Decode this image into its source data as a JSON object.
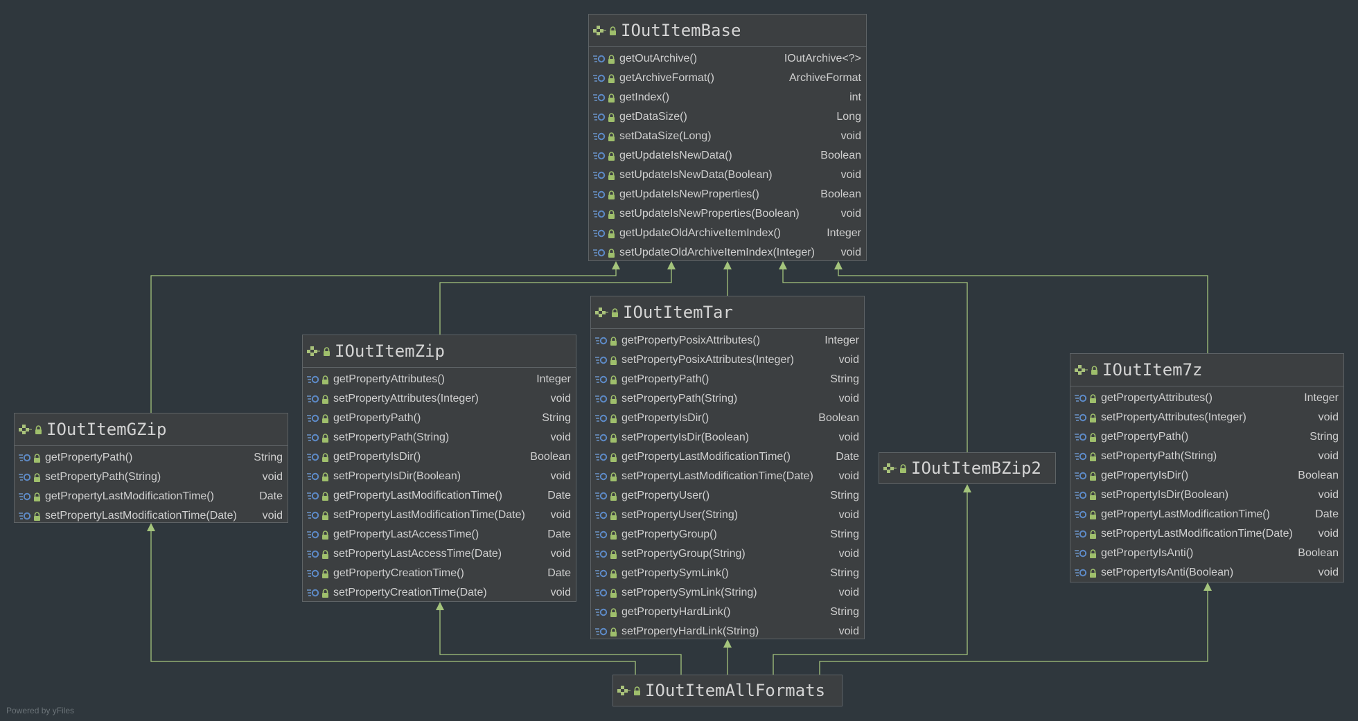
{
  "colors": {
    "background": "#2f373d",
    "edge": "#a4c47c",
    "box": "#3c3f41",
    "border": "#5e6366"
  },
  "classes": {
    "base": {
      "name": "IOutItemBase",
      "members": [
        {
          "name": "getOutArchive()",
          "type": "IOutArchive<?>"
        },
        {
          "name": "getArchiveFormat()",
          "type": "ArchiveFormat"
        },
        {
          "name": "getIndex()",
          "type": "int"
        },
        {
          "name": "getDataSize()",
          "type": "Long"
        },
        {
          "name": "setDataSize(Long)",
          "type": "void"
        },
        {
          "name": "getUpdateIsNewData()",
          "type": "Boolean"
        },
        {
          "name": "setUpdateIsNewData(Boolean)",
          "type": "void"
        },
        {
          "name": "getUpdateIsNewProperties()",
          "type": "Boolean"
        },
        {
          "name": "setUpdateIsNewProperties(Boolean)",
          "type": "void"
        },
        {
          "name": "getUpdateOldArchiveItemIndex()",
          "type": "Integer"
        },
        {
          "name": "setUpdateOldArchiveItemIndex(Integer)",
          "type": "void"
        }
      ]
    },
    "zip": {
      "name": "IOutItemZip",
      "members": [
        {
          "name": "getPropertyAttributes()",
          "type": "Integer"
        },
        {
          "name": "setPropertyAttributes(Integer)",
          "type": "void"
        },
        {
          "name": "getPropertyPath()",
          "type": "String"
        },
        {
          "name": "setPropertyPath(String)",
          "type": "void"
        },
        {
          "name": "getPropertyIsDir()",
          "type": "Boolean"
        },
        {
          "name": "setPropertyIsDir(Boolean)",
          "type": "void"
        },
        {
          "name": "getPropertyLastModificationTime()",
          "type": "Date"
        },
        {
          "name": "setPropertyLastModificationTime(Date)",
          "type": "void"
        },
        {
          "name": "getPropertyLastAccessTime()",
          "type": "Date"
        },
        {
          "name": "setPropertyLastAccessTime(Date)",
          "type": "void"
        },
        {
          "name": "getPropertyCreationTime()",
          "type": "Date"
        },
        {
          "name": "setPropertyCreationTime(Date)",
          "type": "void"
        }
      ]
    },
    "tar": {
      "name": "IOutItemTar",
      "members": [
        {
          "name": "getPropertyPosixAttributes()",
          "type": "Integer"
        },
        {
          "name": "setPropertyPosixAttributes(Integer)",
          "type": "void"
        },
        {
          "name": "getPropertyPath()",
          "type": "String"
        },
        {
          "name": "setPropertyPath(String)",
          "type": "void"
        },
        {
          "name": "getPropertyIsDir()",
          "type": "Boolean"
        },
        {
          "name": "setPropertyIsDir(Boolean)",
          "type": "void"
        },
        {
          "name": "getPropertyLastModificationTime()",
          "type": "Date"
        },
        {
          "name": "setPropertyLastModificationTime(Date)",
          "type": "void"
        },
        {
          "name": "getPropertyUser()",
          "type": "String"
        },
        {
          "name": "setPropertyUser(String)",
          "type": "void"
        },
        {
          "name": "getPropertyGroup()",
          "type": "String"
        },
        {
          "name": "setPropertyGroup(String)",
          "type": "void"
        },
        {
          "name": "getPropertySymLink()",
          "type": "String"
        },
        {
          "name": "setPropertySymLink(String)",
          "type": "void"
        },
        {
          "name": "getPropertyHardLink()",
          "type": "String"
        },
        {
          "name": "setPropertyHardLink(String)",
          "type": "void"
        }
      ]
    },
    "gzip": {
      "name": "IOutItemGZip",
      "members": [
        {
          "name": "getPropertyPath()",
          "type": "String"
        },
        {
          "name": "setPropertyPath(String)",
          "type": "void"
        },
        {
          "name": "getPropertyLastModificationTime()",
          "type": "Date"
        },
        {
          "name": "setPropertyLastModificationTime(Date)",
          "type": "void"
        }
      ]
    },
    "sevenz": {
      "name": "IOutItem7z",
      "members": [
        {
          "name": "getPropertyAttributes()",
          "type": "Integer"
        },
        {
          "name": "setPropertyAttributes(Integer)",
          "type": "void"
        },
        {
          "name": "getPropertyPath()",
          "type": "String"
        },
        {
          "name": "setPropertyPath(String)",
          "type": "void"
        },
        {
          "name": "getPropertyIsDir()",
          "type": "Boolean"
        },
        {
          "name": "setPropertyIsDir(Boolean)",
          "type": "void"
        },
        {
          "name": "getPropertyLastModificationTime()",
          "type": "Date"
        },
        {
          "name": "setPropertyLastModificationTime(Date)",
          "type": "void"
        },
        {
          "name": "getPropertyIsAnti()",
          "type": "Boolean"
        },
        {
          "name": "setPropertyIsAnti(Boolean)",
          "type": "void"
        }
      ]
    },
    "bzip2": {
      "name": "IOutItemBZip2",
      "members": []
    },
    "allformats": {
      "name": "IOutItemAllFormats",
      "members": []
    }
  },
  "footer": "Powered by yFiles"
}
